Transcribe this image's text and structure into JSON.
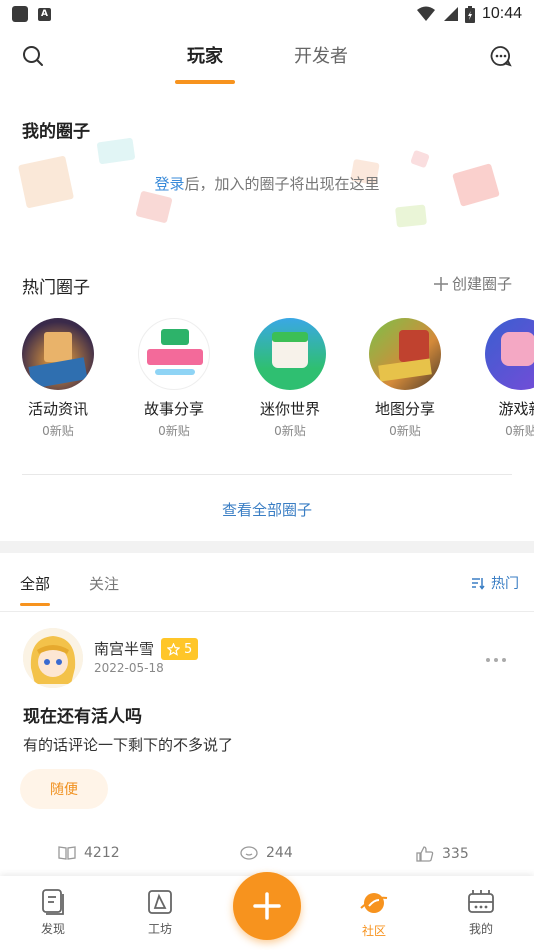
{
  "status_bar": {
    "time": "10:44",
    "left_icons": [
      "app-square-icon",
      "a-badge-icon"
    ],
    "right_icons": [
      "wifi-icon",
      "signal-icon",
      "battery-icon"
    ]
  },
  "top_nav": {
    "tabs": [
      {
        "label": "玩家",
        "active": true
      },
      {
        "label": "开发者",
        "active": false
      }
    ],
    "left_icon": "search-icon",
    "right_icon": "message-icon"
  },
  "my_circles": {
    "title": "我的圈子",
    "hint_link": "登录",
    "hint_rest": "后，加入的圈子将出现在这里"
  },
  "hot_circles": {
    "title": "热门圈子",
    "create_label": "创建圈子",
    "items": [
      {
        "name": "活动资讯",
        "posts": "0新贴"
      },
      {
        "name": "故事分享",
        "posts": "0新贴"
      },
      {
        "name": "迷你世界",
        "posts": "0新贴"
      },
      {
        "name": "地图分享",
        "posts": "0新贴"
      },
      {
        "name": "游戏新",
        "posts": "0新贴"
      }
    ],
    "view_all": "查看全部圈子"
  },
  "feed": {
    "tabs": [
      {
        "label": "全部",
        "active": true
      },
      {
        "label": "关注",
        "active": false
      }
    ],
    "sort_label": "热门"
  },
  "post": {
    "user": "南宫半雪",
    "level": "5",
    "date": "2022-05-18",
    "title": "现在还有活人吗",
    "body": "有的话评论一下剩下的不多说了",
    "tag": "随便",
    "stats": {
      "views": "4212",
      "comments": "244",
      "likes": "335"
    }
  },
  "bottom_nav": {
    "items": [
      {
        "label": "发现",
        "icon": "discover-icon",
        "active": false
      },
      {
        "label": "工坊",
        "icon": "workshop-icon",
        "active": false
      },
      {
        "label": "社区",
        "icon": "community-planet-icon",
        "active": true
      },
      {
        "label": "我的",
        "icon": "profile-icon",
        "active": false
      }
    ],
    "fab_icon": "plus-icon"
  },
  "colors": {
    "accent": "#f7931e",
    "link": "#3a7ec4",
    "badge": "#ffc629"
  }
}
